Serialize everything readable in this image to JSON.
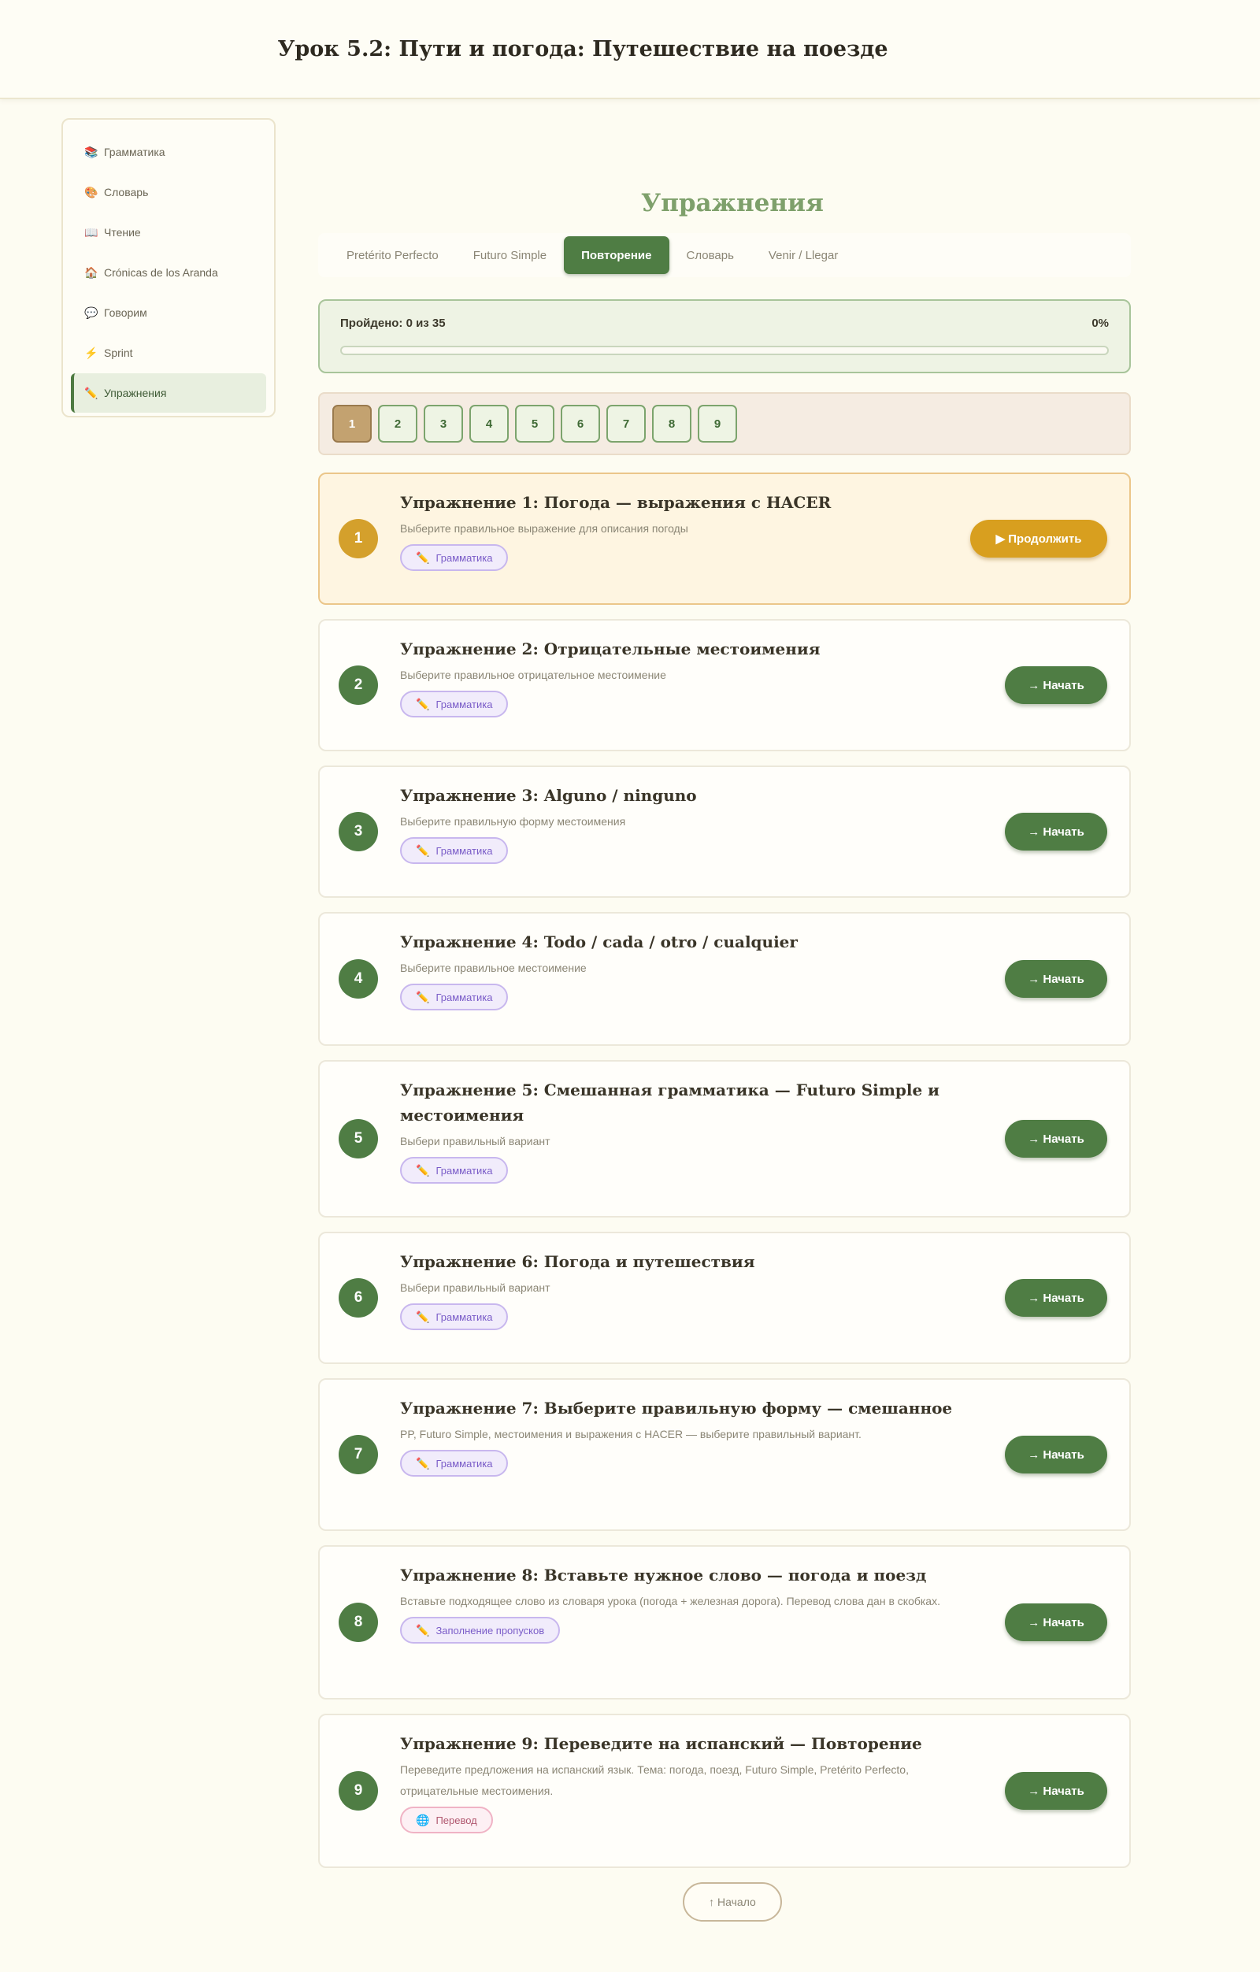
{
  "header": {
    "title": "Урок 5.2: Пути и погода: Путешествие на поезде"
  },
  "sidebar": {
    "items": [
      {
        "icon": "📚",
        "label": "Грамматика"
      },
      {
        "icon": "🎨",
        "label": "Словарь"
      },
      {
        "icon": "📖",
        "label": "Чтение"
      },
      {
        "icon": "🏠",
        "label": "Crónicas de los Aranda"
      },
      {
        "icon": "💬",
        "label": "Говорим"
      },
      {
        "icon": "⚡",
        "label": "Sprint"
      },
      {
        "icon": "✏️",
        "label": "Упражнения"
      }
    ]
  },
  "main": {
    "section_title": "Упражнения",
    "tabs": [
      "Pretérito Perfecto",
      "Futuro Simple",
      "Повторение",
      "Словарь",
      "Venir / Llegar"
    ],
    "progress": {
      "label": "Пройдено: 0 из 35",
      "percent_label": "0%",
      "percent": 0
    },
    "numbers": [
      "1",
      "2",
      "3",
      "4",
      "5",
      "6",
      "7",
      "8",
      "9"
    ],
    "exercises": [
      {
        "num": "1",
        "title": "Упражнение 1: Погода — выражения с HACER",
        "desc": "Выберите правильное выражение для описания погоды",
        "tag": "Грамматика",
        "tag_icon": "✏️",
        "button": "▶ Продолжить"
      },
      {
        "num": "2",
        "title": "Упражнение 2: Отрицательные местоимения",
        "desc": "Выберите правильное отрицательное местоимение",
        "tag": "Грамматика",
        "tag_icon": "✏️",
        "button": "→ Начать"
      },
      {
        "num": "3",
        "title": "Упражнение 3: Alguno / ninguno",
        "desc": "Выберите правильную форму местоимения",
        "tag": "Грамматика",
        "tag_icon": "✏️",
        "button": "→ Начать"
      },
      {
        "num": "4",
        "title": "Упражнение 4: Todo / cada / otro / cualquier",
        "desc": "Выберите правильное местоимение",
        "tag": "Грамматика",
        "tag_icon": "✏️",
        "button": "→ Начать"
      },
      {
        "num": "5",
        "title": "Упражнение 5: Смешанная грамматика — Futuro Simple и местоимения",
        "desc": "Выбери правильный вариант",
        "tag": "Грамматика",
        "tag_icon": "✏️",
        "button": "→ Начать"
      },
      {
        "num": "6",
        "title": "Упражнение 6: Погода и путешествия",
        "desc": "Выбери правильный вариант",
        "tag": "Грамматика",
        "tag_icon": "✏️",
        "button": "→ Начать"
      },
      {
        "num": "7",
        "title": "Упражнение 7: Выберите правильную форму — смешанное",
        "desc": "PP, Futuro Simple, местоимения и выражения с HACER — выберите правильный вариант.",
        "tag": "Грамматика",
        "tag_icon": "✏️",
        "button": "→ Начать"
      },
      {
        "num": "8",
        "title": "Упражнение 8: Вставьте нужное слово — погода и поезд",
        "desc": "Вставьте подходящее слово из словаря урока (погода + железная дорога). Перевод слова дан в скобках.",
        "tag": "Заполнение пропусков",
        "tag_icon": "✏️",
        "button": "→ Начать"
      },
      {
        "num": "9",
        "title": "Упражнение 9: Переведите на испанский — Повторение",
        "desc": "Переведите предложения на испанский язык. Тема: погода, поезд, Futuro Simple, Pretérito Perfecto, отрицательные местоимения.",
        "tag": "Перевод",
        "tag_icon": "🌐",
        "button": "→ Начать"
      }
    ],
    "back_button": "↑ Начало"
  }
}
